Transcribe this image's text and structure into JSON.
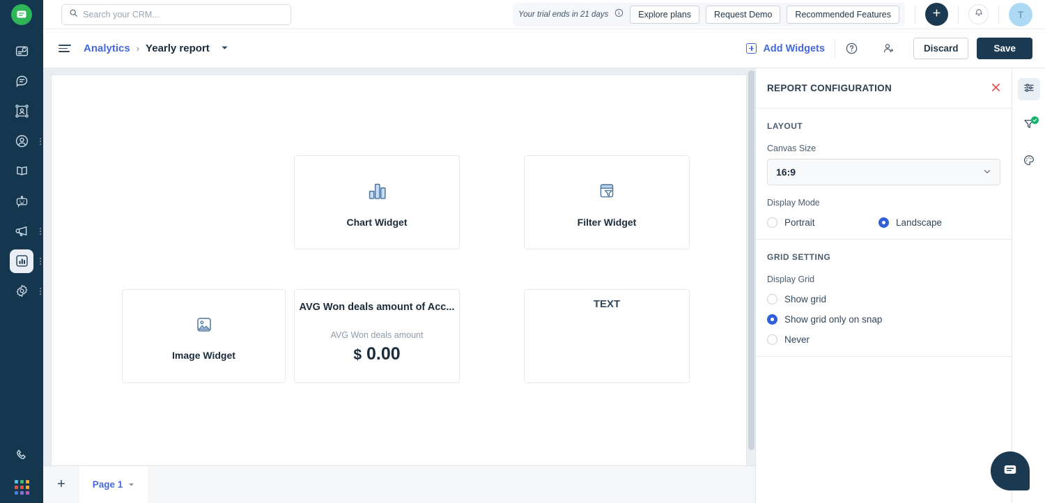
{
  "topbar": {
    "search": {
      "placeholder": "Search your CRM...",
      "value": ""
    },
    "trial_text": "Your trial ends in 21 days",
    "buttons": [
      {
        "label": "Explore plans",
        "name": "explore-plans-button"
      },
      {
        "label": "Request Demo",
        "name": "request-demo-button"
      },
      {
        "label": "Recommended Features",
        "name": "recommended-features-button"
      }
    ],
    "avatar_initial": "T"
  },
  "subbar": {
    "breadcrumb_parent": "Analytics",
    "breadcrumb_sep": "›",
    "breadcrumb_current": "Yearly report",
    "add_widgets_label": "Add Widgets",
    "discard_label": "Discard",
    "save_label": "Save"
  },
  "canvas": {
    "widgets": [
      {
        "name": "chart-widget",
        "label": "Chart Widget",
        "icon": "bar-chart-icon"
      },
      {
        "name": "filter-widget",
        "label": "Filter Widget",
        "icon": "filter-panel-icon"
      },
      {
        "name": "image-widget",
        "label": "Image Widget",
        "icon": "image-icon"
      },
      {
        "name": "kpi-widget",
        "title": "AVG Won deals amount of Acc...",
        "subtitle": "AVG Won deals amount",
        "currency": "$",
        "value": "0.00"
      },
      {
        "name": "text-widget",
        "label": "TEXT"
      }
    ]
  },
  "pagebar": {
    "add_label": "+",
    "page_label": "Page 1"
  },
  "config": {
    "title": "REPORT CONFIGURATION",
    "layout": {
      "section_title": "LAYOUT",
      "canvas_size_label": "Canvas Size",
      "canvas_size_value": "16:9",
      "display_mode_label": "Display Mode",
      "options": [
        {
          "label": "Portrait",
          "checked": false
        },
        {
          "label": "Landscape",
          "checked": true
        }
      ]
    },
    "grid": {
      "section_title": "GRID SETTING",
      "display_grid_label": "Display Grid",
      "options": [
        {
          "label": "Show grid",
          "checked": false
        },
        {
          "label": "Show grid only on snap",
          "checked": true
        },
        {
          "label": "Never",
          "checked": false
        }
      ]
    }
  },
  "left_rail": {
    "items": [
      {
        "name": "sidebar-item-inbox",
        "icon": "card-arrow-icon",
        "dots": false
      },
      {
        "name": "sidebar-item-conversations",
        "icon": "chat-lines-icon",
        "dots": false
      },
      {
        "name": "sidebar-item-workflows",
        "icon": "nodes-user-icon",
        "dots": false
      },
      {
        "name": "sidebar-item-contacts",
        "icon": "user-circle-icon",
        "dots": true
      },
      {
        "name": "sidebar-item-knowledge",
        "icon": "open-book-icon",
        "dots": false
      },
      {
        "name": "sidebar-item-bots",
        "icon": "robot-icon",
        "dots": false
      },
      {
        "name": "sidebar-item-campaigns",
        "icon": "megaphone-icon",
        "dots": true
      },
      {
        "name": "sidebar-item-analytics",
        "icon": "bar-chart-square-icon",
        "dots": true,
        "active": true
      },
      {
        "name": "sidebar-item-settings",
        "icon": "gear-icon",
        "dots": true
      }
    ],
    "bottom": [
      {
        "name": "sidebar-item-calls",
        "icon": "phone-icon"
      },
      {
        "name": "sidebar-item-apps",
        "icon": "app-grid-icon"
      }
    ]
  },
  "right_rail": {
    "items": [
      {
        "name": "report-configuration-tab",
        "icon": "sliders-icon",
        "active": true
      },
      {
        "name": "filters-tab",
        "icon": "filter-check-icon",
        "active": false,
        "badge": true
      },
      {
        "name": "theme-tab",
        "icon": "palette-icon",
        "active": false
      }
    ]
  },
  "chat": {
    "name": "chat-bubble-button",
    "icon": "chat-icon"
  },
  "colors": {
    "rail_bg": "#14364f",
    "accent_blue": "#4568dc",
    "radio_blue": "#2f5fd9",
    "save_bg": "#1b3a52",
    "brand_green": "#2fb457",
    "close_red": "#d9534f",
    "widget_icon": "#a8c4e0",
    "badge_green": "#18b26b"
  }
}
